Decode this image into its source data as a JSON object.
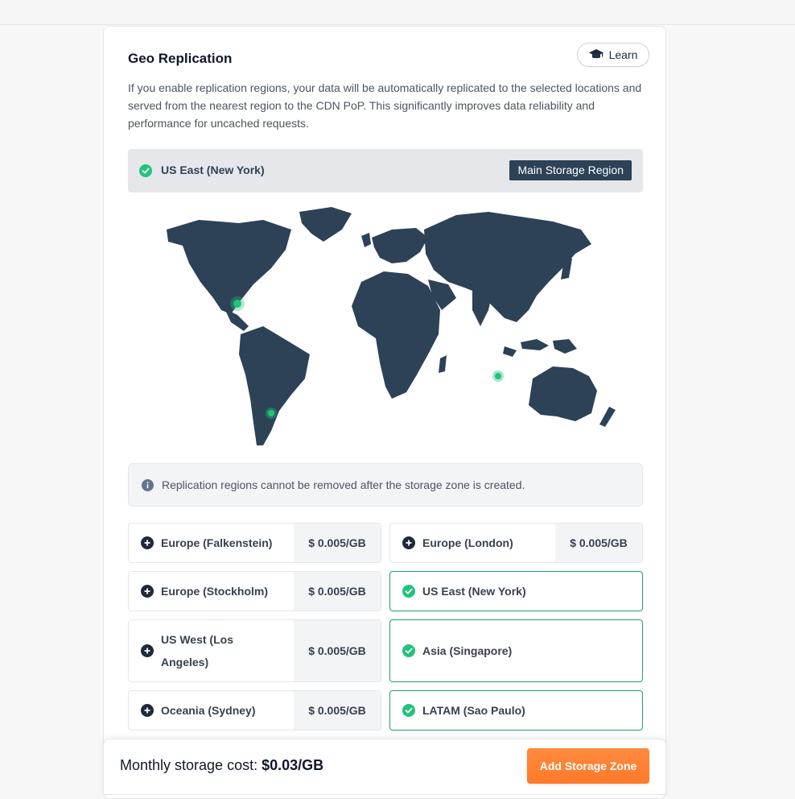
{
  "card": {
    "title": "Geo Replication",
    "learn_label": "Learn",
    "description": "If you enable replication regions, your data will be automatically replicated to the selected locations and served from the nearest region to the CDN PoP. This significantly improves data reliability and performance for uncached requests."
  },
  "main_region": {
    "name": "US East (New York)",
    "badge": "Main Storage Region"
  },
  "notice": "Replication regions cannot be removed after the storage zone is created.",
  "regions": [
    {
      "name": "Europe (Falkenstein)",
      "price": "$ 0.005/GB",
      "selected": false
    },
    {
      "name": "Europe (London)",
      "price": "$ 0.005/GB",
      "selected": false
    },
    {
      "name": "Europe (Stockholm)",
      "price": "$ 0.005/GB",
      "selected": false
    },
    {
      "name": "US East (New York)",
      "price": "",
      "selected": true
    },
    {
      "name": "US West (Los Angeles)",
      "price": "$ 0.005/GB",
      "selected": false
    },
    {
      "name": "Asia (Singapore)",
      "price": "",
      "selected": true
    },
    {
      "name": "Oceania (Sydney)",
      "price": "$ 0.005/GB",
      "selected": false
    },
    {
      "name": "LATAM (Sao Paulo)",
      "price": "",
      "selected": true
    }
  ],
  "footer": {
    "cost_label": "Monthly storage cost:",
    "cost_value": "$0.03/GB",
    "add_button": "Add Storage Zone"
  },
  "colors": {
    "accent_green": "#22c37a",
    "map_fill": "#2d4157",
    "button_orange": "#ff7a2a",
    "badge_bg": "#2d4157"
  }
}
